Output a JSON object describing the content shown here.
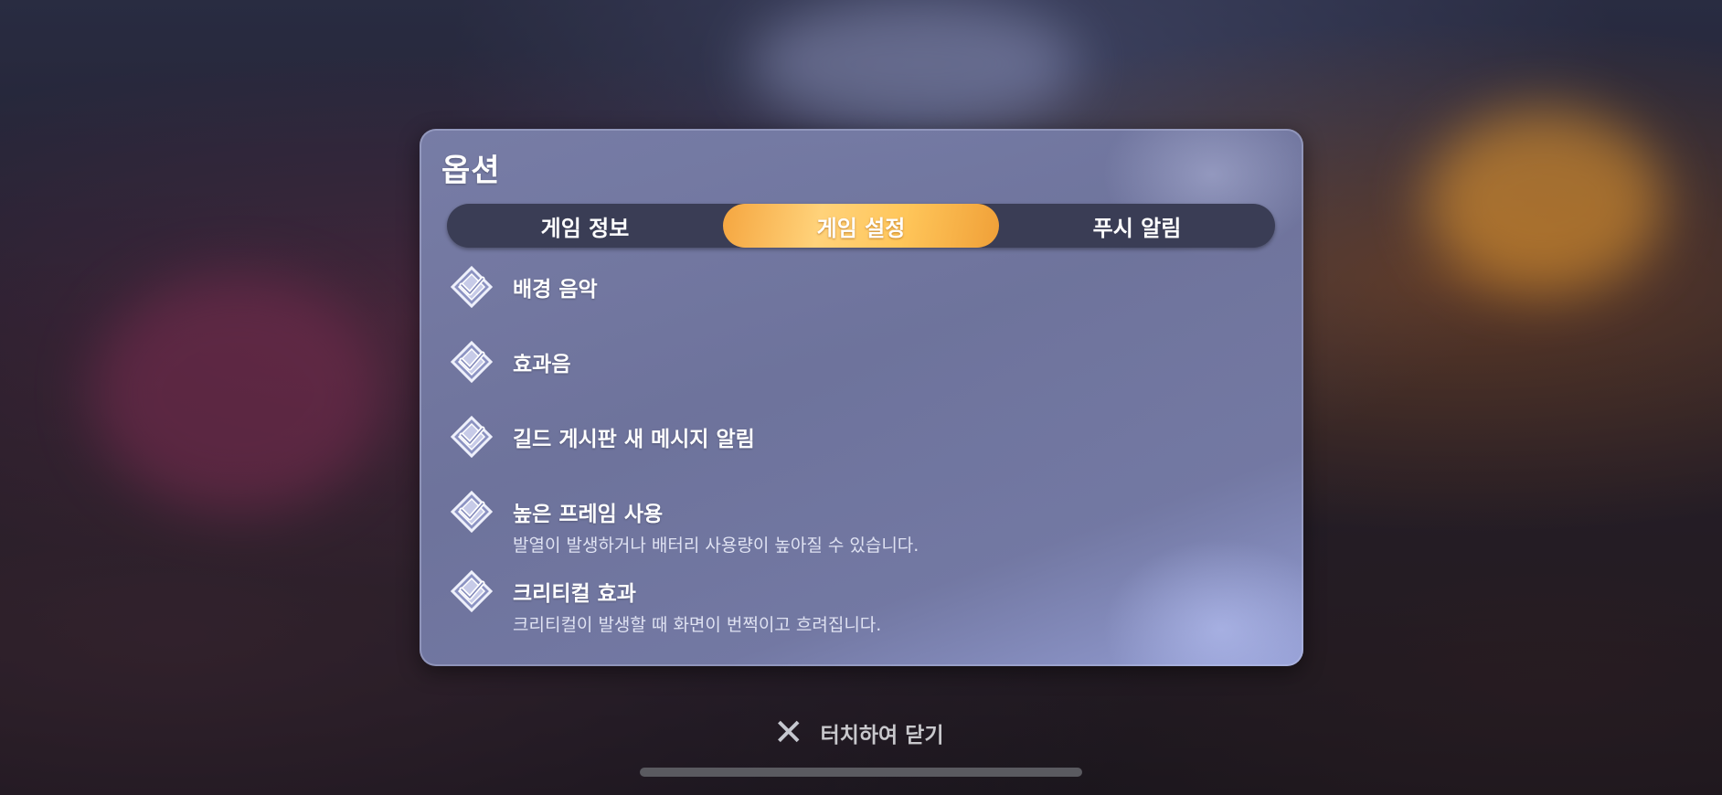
{
  "dialog": {
    "title": "옵션",
    "tabs": [
      {
        "label": "게임 정보",
        "active": false
      },
      {
        "label": "게임 설정",
        "active": true
      },
      {
        "label": "푸시 알림",
        "active": false
      }
    ],
    "options": [
      {
        "label": "배경 음악",
        "description": "",
        "checked": true
      },
      {
        "label": "효과음",
        "description": "",
        "checked": true
      },
      {
        "label": "길드 게시판 새 메시지 알림",
        "description": "",
        "checked": true
      },
      {
        "label": "높은 프레임 사용",
        "description": "발열이 발생하거나 배터리 사용량이 높아질 수 있습니다.",
        "checked": true
      },
      {
        "label": "크리티컬 효과",
        "description": "크리티컬이 발생할 때 화면이 번쩍이고 흐려집니다.",
        "checked": true
      }
    ]
  },
  "close": {
    "icon": "close-x-icon",
    "label": "터치하여 닫기"
  },
  "colors": {
    "panel": "#7a80aa",
    "tabbar": "#3a3d55",
    "active_tab": "#ffc65a",
    "checkbox": "#e8ecfb"
  }
}
